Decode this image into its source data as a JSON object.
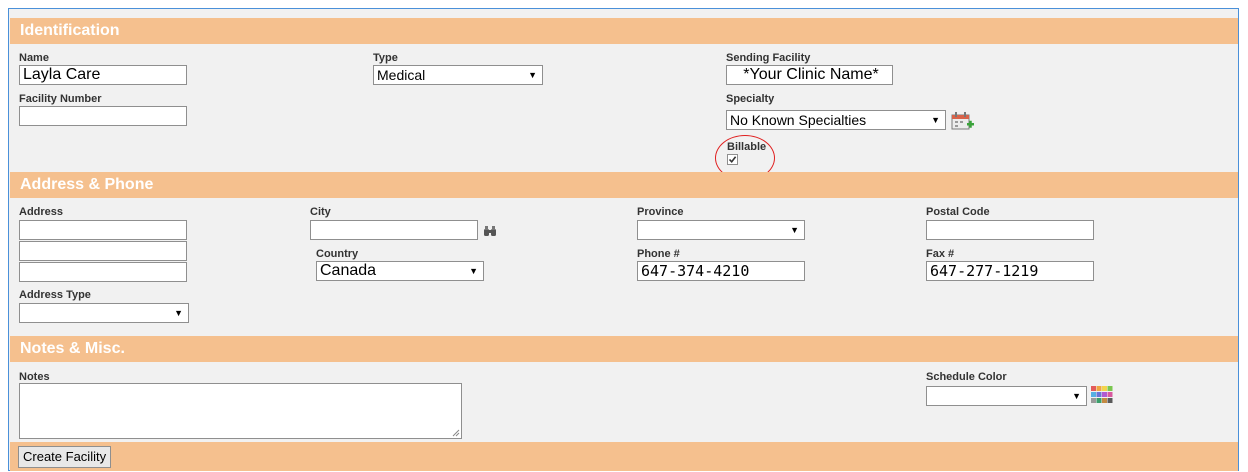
{
  "sections": {
    "identification": "Identification",
    "address_phone": "Address & Phone",
    "notes_misc": "Notes & Misc."
  },
  "identification": {
    "name_label": "Name",
    "name_value": "Layla Care",
    "type_label": "Type",
    "type_value": "Medical",
    "sending_facility_label": "Sending Facility",
    "sending_facility_value": "*Your Clinic Name*",
    "facility_number_label": "Facility Number",
    "facility_number_value": "",
    "specialty_label": "Specialty",
    "specialty_value": "No Known Specialties",
    "billable_label": "Billable",
    "billable_checked": true
  },
  "address": {
    "address_label": "Address",
    "city_label": "City",
    "province_label": "Province",
    "province_value": "",
    "postal_code_label": "Postal Code",
    "country_label": "Country",
    "country_value": "Canada",
    "phone_label": "Phone #",
    "phone_value": "647-374-4210",
    "fax_label": "Fax #",
    "fax_value": "647-277-1219",
    "address_type_label": "Address Type",
    "address_type_value": ""
  },
  "notes": {
    "notes_label": "Notes",
    "schedule_color_label": "Schedule Color",
    "schedule_color_value": ""
  },
  "buttons": {
    "create_facility": "Create Facility"
  },
  "colors": {
    "section_bar": "#f5c08e",
    "highlight_circle": "#e02020",
    "frame_border": "#4a90d9"
  },
  "icons": {
    "city_lookup": "binoculars-icon",
    "add_specialty": "add-calendar-icon",
    "color_picker": "color-grid-icon"
  }
}
